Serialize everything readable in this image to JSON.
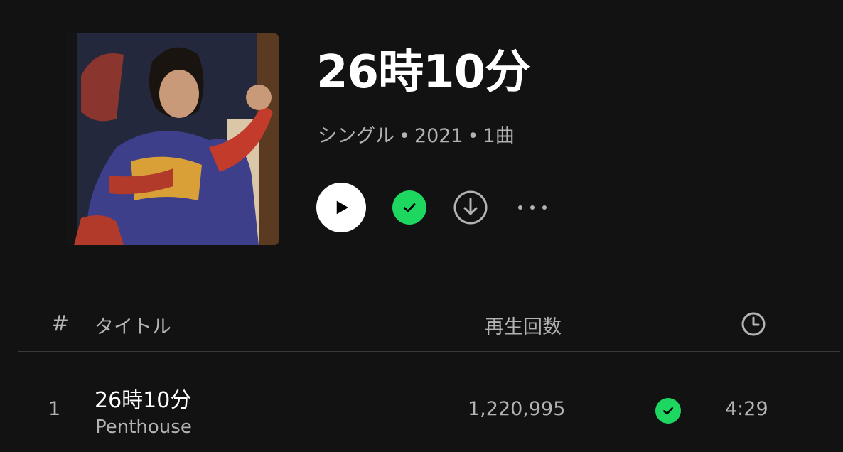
{
  "album": {
    "title": "26時10分",
    "type": "シングル",
    "year": "2021",
    "track_count": "1曲",
    "separator": "•"
  },
  "controls": {
    "play_icon": "play-icon",
    "saved_icon": "check-icon",
    "download_icon": "download-icon",
    "more_label": "···"
  },
  "table_header": {
    "index": "#",
    "title": "タイトル",
    "plays": "再生回数",
    "duration_icon": "clock-icon"
  },
  "tracks": [
    {
      "index": "1",
      "title": "26時10分",
      "artist": "Penthouse",
      "plays": "1,220,995",
      "saved": true,
      "duration": "4:29"
    }
  ],
  "colors": {
    "background": "#121212",
    "accent_green": "#1ed760",
    "text_primary": "#ffffff",
    "text_secondary": "#b3b3b3"
  }
}
